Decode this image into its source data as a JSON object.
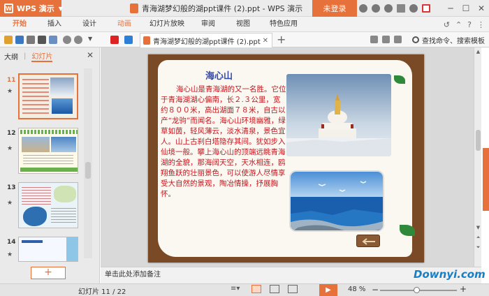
{
  "app": {
    "name": "WPS 演示",
    "logo_text": "W",
    "brand_color": "#e7713a"
  },
  "document": {
    "title": "青海湖梦幻般的湖ppt课件 (2).ppt - WPS 演示",
    "tab_label": "青海湖梦幻般的湖ppt课件 (2).ppt"
  },
  "titlebar": {
    "login_label": "未登录"
  },
  "menu": {
    "items": [
      "开始",
      "插入",
      "设计",
      "动画",
      "幻灯片放映",
      "审阅",
      "视图",
      "特色应用"
    ],
    "active_index": 3
  },
  "toolbar": {
    "search_label": "查找命令、搜索模板",
    "add_tab": "+"
  },
  "left_panel": {
    "tabs": [
      "大纲",
      "幻灯片"
    ],
    "active_tab": "幻灯片",
    "slides": [
      {
        "number": "11",
        "selected": true
      },
      {
        "number": "12",
        "selected": false
      },
      {
        "number": "13",
        "selected": false
      },
      {
        "number": "14",
        "selected": false
      }
    ],
    "add_label": "+"
  },
  "slide": {
    "title": "海心山",
    "body": "海心山是青海湖的又一名胜。它位于青海湖湖心偏南，长２.３公里，宽约８００米，高出湖面７８米，自古以产“龙驹”而闻名。海心山环境幽雅，绿草如茵，轻风薄云，淡水清泉，景色宜人。山上古刹白塔隐存其间。犹如步入仙境一般。攀上海心山的顶端远眺青海湖的全貌，那海阔天空，天水相连，鸥翔鱼跃的壮丽景色，可以使游人尽情享受大自然的景观，陶冶情操，抒展胸怀。",
    "text_color": "#c7141c",
    "title_color": "#3548a8"
  },
  "notes": {
    "placeholder": "单击此处添加备注"
  },
  "status": {
    "slide_counter": "幻灯片 11 / 22",
    "zoom": "48 %",
    "zoom_fraction": 0.48
  },
  "watermark": "Downyi.com"
}
